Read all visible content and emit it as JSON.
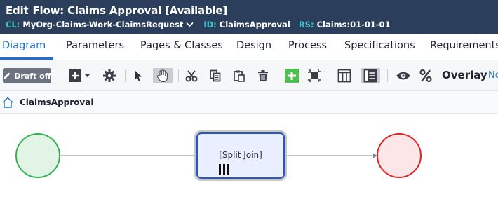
{
  "header": {
    "edit_label": "Edit",
    "title": "Flow: Claims Approval [Available]",
    "class_key": "CL:",
    "class_value": "MyOrg-Claims-Work-ClaimsRequest",
    "id_key": "ID:",
    "id_value": "ClaimsApproval",
    "rs_key": "RS:",
    "rs_value": "Claims:01-01-01"
  },
  "tabs": [
    {
      "label": "Diagram",
      "active": true
    },
    {
      "label": "Parameters"
    },
    {
      "label": "Pages & Classes"
    },
    {
      "label": "Design"
    },
    {
      "label": "Process"
    },
    {
      "label": "Specifications"
    },
    {
      "label": "Requirements"
    }
  ],
  "toolbar": {
    "draft_label": "Draft off",
    "overlay_label": "Overlay",
    "overlay_value": "No"
  },
  "breadcrumb": {
    "label": "ClaimsApproval"
  },
  "diagram": {
    "split_join_label": "[Split Join]",
    "start_color": "#2fb44f",
    "end_color": "#e02424",
    "shape_border_color": "#2456c7"
  }
}
